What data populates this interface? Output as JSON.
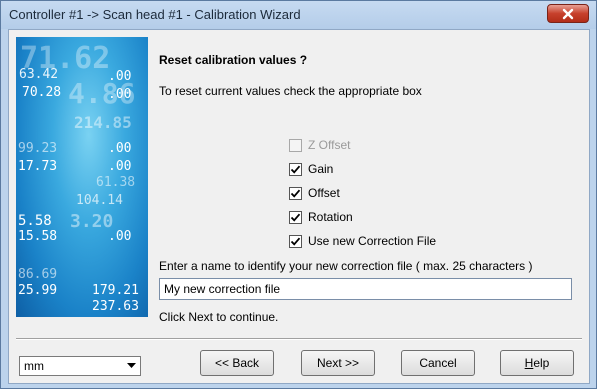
{
  "window": {
    "title": "Controller #1 -> Scan head #1 - Calibration Wizard"
  },
  "side_image": {
    "numbers": [
      "71.62",
      "63.42",
      ".00",
      "70.28",
      "4.86",
      ".00",
      "214.85",
      "99.23",
      ".00",
      "17.73",
      ".00",
      "61.38",
      "104.14",
      "5.58",
      "3.20",
      "15.58",
      ".00",
      "86.69",
      "25.99",
      "179.21",
      "237.63"
    ]
  },
  "content": {
    "heading": "Reset calibration values ?",
    "instruction": "To reset current values check the appropriate box",
    "checkboxes": [
      {
        "label": "Z Offset",
        "checked": false,
        "disabled": true
      },
      {
        "label": "Gain",
        "checked": true,
        "disabled": false
      },
      {
        "label": "Offset",
        "checked": true,
        "disabled": false
      },
      {
        "label": "Rotation",
        "checked": true,
        "disabled": false
      },
      {
        "label": "Use new Correction File",
        "checked": true,
        "disabled": false
      }
    ],
    "name_prompt": "Enter a name to identify your new correction file ( max. 25 characters )",
    "name_value": "My new correction file",
    "continue_hint": "Click Next to continue."
  },
  "footer": {
    "unit_value": "mm",
    "back_label": "<< Back",
    "next_label": "Next >>",
    "cancel_label": "Cancel",
    "help_underlined": "H",
    "help_rest": "elp"
  },
  "colors": {
    "title_bar": "#bcd3ec",
    "close_button": "#c7402c",
    "image_blue": "#1a82c8"
  }
}
